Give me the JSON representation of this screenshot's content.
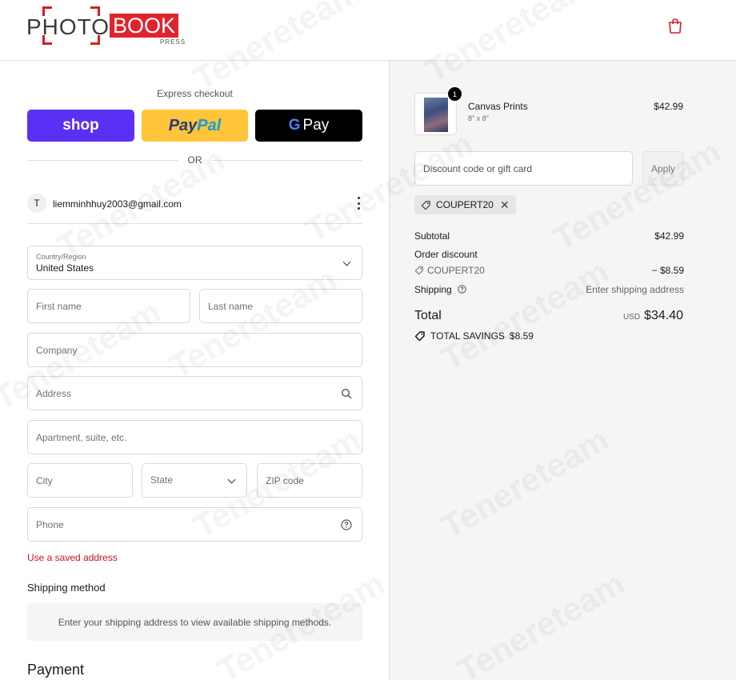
{
  "brand": {
    "photo": "PHOTO",
    "book": "BOOK",
    "press": "PRESS",
    "accent": "#e0242e"
  },
  "watermark": "Tenereteam",
  "checkout": {
    "express_label": "Express checkout",
    "shop_label": "shop",
    "paypal_part1": "Pay",
    "paypal_part2": "Pal",
    "gpay_g": "G",
    "gpay_label": "Pay",
    "or_label": "OR",
    "account": {
      "initial": "T",
      "email": "liemminhhuy2003@gmail.com"
    },
    "country": {
      "label": "Country/Region",
      "value": "United States"
    },
    "first_name_ph": "First name",
    "last_name_ph": "Last name",
    "company_ph": "Company",
    "address_ph": "Address",
    "apartment_ph": "Apartment, suite, etc.",
    "city_ph": "City",
    "state_ph": "State",
    "zip_ph": "ZIP code",
    "phone_ph": "Phone",
    "saved_address_link": "Use a saved address",
    "shipping_method_title": "Shipping method",
    "shipping_method_note": "Enter your shipping address to view available shipping methods.",
    "payment_title": "Payment"
  },
  "summary": {
    "item": {
      "qty": "1",
      "name": "Canvas Prints",
      "variant": "8\" x 8\"",
      "price": "$42.99"
    },
    "discount_ph": "Discount code or gift card",
    "apply_label": "Apply",
    "coupon_code": "COUPERT20",
    "subtotal_label": "Subtotal",
    "subtotal_value": "$42.99",
    "order_discount_label": "Order discount",
    "discount_code": "COUPERT20",
    "discount_value": "− $8.59",
    "shipping_label": "Shipping",
    "shipping_value": "Enter shipping address",
    "total_label": "Total",
    "currency": "USD",
    "total_value": "$34.40",
    "savings_label": "TOTAL SAVINGS",
    "savings_value": "$8.59"
  }
}
